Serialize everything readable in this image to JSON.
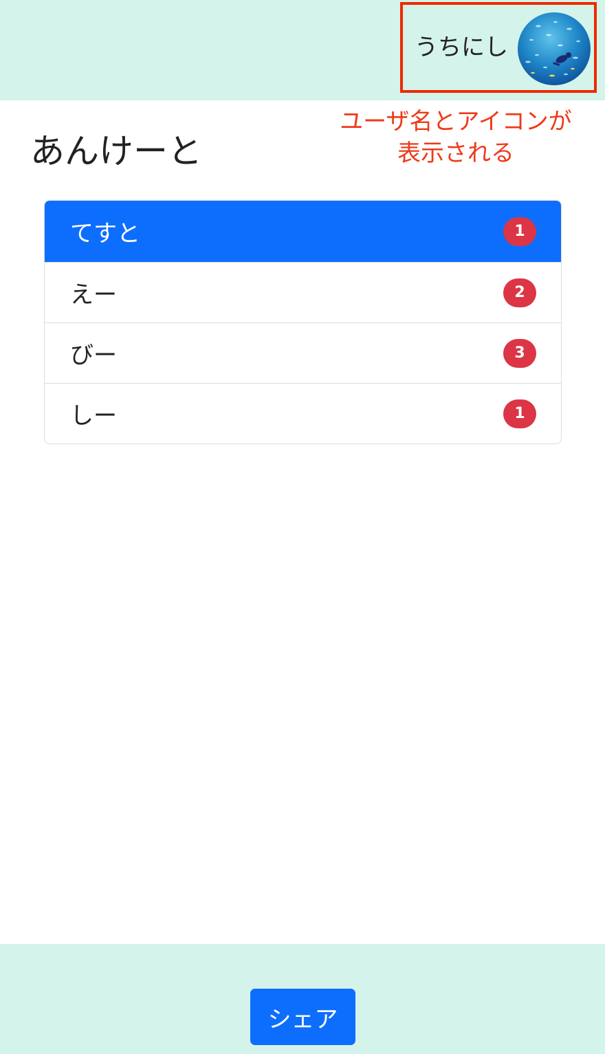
{
  "header": {
    "username": "うちにし",
    "avatar_icon": "user-avatar-icon"
  },
  "annotation": {
    "line1": "ユーザ名とアイコンが",
    "line2": "表示される",
    "color": "#ee3a1a"
  },
  "page": {
    "title": "あんけーと"
  },
  "options": [
    {
      "label": "てすと",
      "count": "1",
      "active": true
    },
    {
      "label": "えー",
      "count": "2",
      "active": false
    },
    {
      "label": "びー",
      "count": "3",
      "active": false
    },
    {
      "label": "しー",
      "count": "1",
      "active": false
    }
  ],
  "footer": {
    "share_label": "シェア"
  },
  "colors": {
    "header_bg": "#d4f3ea",
    "accent": "#0d6efd",
    "badge": "#dc3545",
    "highlight": "#ee2a00"
  }
}
